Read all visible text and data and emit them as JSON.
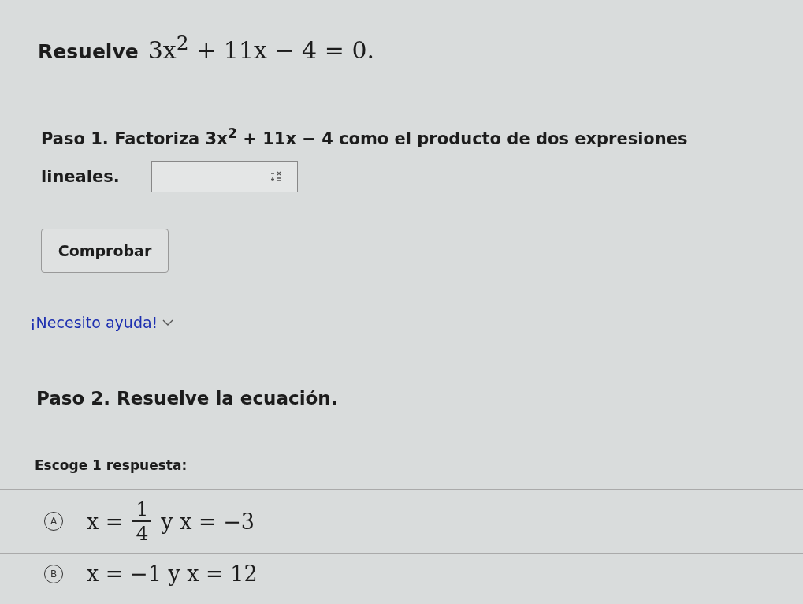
{
  "title": {
    "label": "Resuelve",
    "math": "3x$^{2}$ + 11x − 4 = 0."
  },
  "step1": {
    "lines": [
      "Paso 1. Factoriza 3x$^{2}$ + 11x − 4 como el producto de dos expresiones",
      "lineales."
    ],
    "check_button": "Comprobar"
  },
  "help": {
    "label": "¡Necesito ayuda!",
    "expanded": false
  },
  "step2": {
    "text": "Paso 2. Resuelve la ecuación.",
    "prompt": "Escoge 1 respuesta:"
  },
  "options": [
    {
      "letter": "A",
      "kind": "fraction",
      "selected": false,
      "before": "x =",
      "numerator": "1",
      "denominator": "4",
      "after": "y x = −3"
    },
    {
      "letter": "B",
      "kind": "plain",
      "selected": false,
      "text": "x = −1 y x = 12"
    }
  ]
}
